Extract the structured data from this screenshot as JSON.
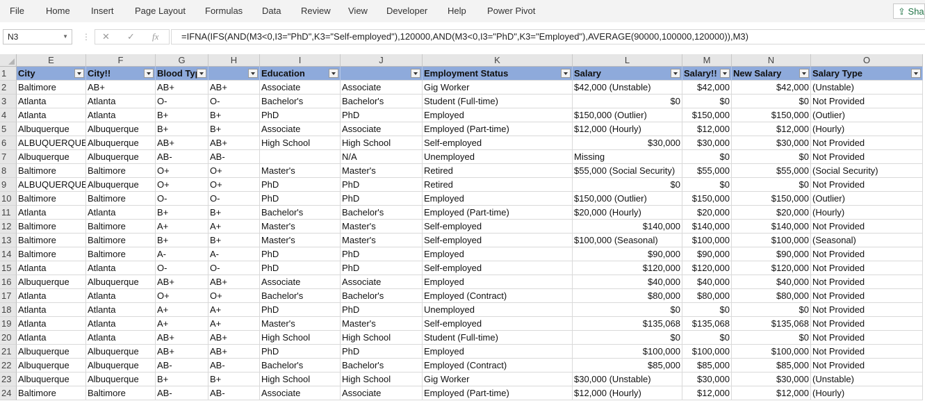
{
  "ribbon": {
    "tabs": [
      "File",
      "Home",
      "Insert",
      "Page Layout",
      "Formulas",
      "Data",
      "Review",
      "View",
      "Developer",
      "Help",
      "Power Pivot"
    ],
    "share_label": "Sha"
  },
  "formula_bar": {
    "name_box": "N3",
    "formula": "=IFNA(IFS(AND(M3<0,I3=\"PhD\",K3=\"Self-employed\"),120000,AND(M3<0,I3=\"PhD\",K3=\"Employed\"),AVERAGE(90000,100000,120000)),M3)"
  },
  "columns": [
    "E",
    "F",
    "G",
    "H",
    "I",
    "J",
    "K",
    "L",
    "M",
    "N",
    "O"
  ],
  "header_row": {
    "number": "1",
    "cells": [
      "City",
      "City!!",
      "Blood Typ",
      "",
      "Education",
      "",
      "Employment Status",
      "Salary",
      "Salary!!",
      "New Salary",
      "Salary Type"
    ]
  },
  "rows": [
    {
      "n": "2",
      "c": [
        "Baltimore",
        "AB+",
        "AB+",
        "AB+",
        "Associate",
        "Associate",
        "Gig Worker",
        "$42,000 (Unstable)",
        "$42,000",
        "$42,000",
        "(Unstable)"
      ]
    },
    {
      "n": "3",
      "c": [
        "Atlanta",
        "Atlanta",
        "O-",
        "O-",
        "Bachelor's",
        "Bachelor's",
        "Student (Full-time)",
        "$0",
        "$0",
        "$0",
        "Not Provided"
      ]
    },
    {
      "n": "4",
      "c": [
        "Atlanta",
        "Atlanta",
        "B+",
        "B+",
        "PhD",
        "PhD",
        "Employed",
        "$150,000 (Outlier)",
        "$150,000",
        "$150,000",
        "(Outlier)"
      ]
    },
    {
      "n": "5",
      "c": [
        "Albuquerque",
        "Albuquerque",
        "B+",
        "B+",
        "Associate",
        "Associate",
        "Employed (Part-time)",
        "$12,000 (Hourly)",
        "$12,000",
        "$12,000",
        "(Hourly)"
      ]
    },
    {
      "n": "6",
      "c": [
        "ALBUQUERQUE",
        "Albuquerque",
        "AB+",
        "AB+",
        "High School",
        "High School",
        "Self-employed",
        "$30,000",
        "$30,000",
        "$30,000",
        "Not Provided"
      ]
    },
    {
      "n": "7",
      "c": [
        "Albuquerque",
        "Albuquerque",
        "AB-",
        "AB-",
        "",
        "N/A",
        "Unemployed",
        "Missing",
        "$0",
        "$0",
        "Not Provided"
      ]
    },
    {
      "n": "8",
      "c": [
        "Baltimore",
        "Baltimore",
        "O+",
        "O+",
        "Master's",
        "Master's",
        "Retired",
        "$55,000 (Social Security)",
        "$55,000",
        "$55,000",
        "(Social Security)"
      ]
    },
    {
      "n": "9",
      "c": [
        "ALBUQUERQUE",
        "Albuquerque",
        "O+",
        "O+",
        "PhD",
        "PhD",
        "Retired",
        "$0",
        "$0",
        "$0",
        "Not Provided"
      ]
    },
    {
      "n": "10",
      "c": [
        "Baltimore",
        "Baltimore",
        "O-",
        "O-",
        "PhD",
        "PhD",
        "Employed",
        "$150,000 (Outlier)",
        "$150,000",
        "$150,000",
        "(Outlier)"
      ]
    },
    {
      "n": "11",
      "c": [
        "Atlanta",
        "Atlanta",
        "B+",
        "B+",
        "Bachelor's",
        "Bachelor's",
        "Employed (Part-time)",
        "$20,000 (Hourly)",
        "$20,000",
        "$20,000",
        "(Hourly)"
      ]
    },
    {
      "n": "12",
      "c": [
        "Baltimore",
        "Baltimore",
        "A+",
        "A+",
        "Master's",
        "Master's",
        "Self-employed",
        "$140,000",
        "$140,000",
        "$140,000",
        "Not Provided"
      ]
    },
    {
      "n": "13",
      "c": [
        "Baltimore",
        "Baltimore",
        "B+",
        "B+",
        "Master's",
        "Master's",
        "Self-employed",
        "$100,000 (Seasonal)",
        "$100,000",
        "$100,000",
        "(Seasonal)"
      ]
    },
    {
      "n": "14",
      "c": [
        "Baltimore",
        "Baltimore",
        "A-",
        "A-",
        "PhD",
        "PhD",
        "Employed",
        "$90,000",
        "$90,000",
        "$90,000",
        "Not Provided"
      ]
    },
    {
      "n": "15",
      "c": [
        "Atlanta",
        "Atlanta",
        "O-",
        "O-",
        "PhD",
        "PhD",
        "Self-employed",
        "$120,000",
        "$120,000",
        "$120,000",
        "Not Provided"
      ]
    },
    {
      "n": "16",
      "c": [
        "Albuquerque",
        "Albuquerque",
        "AB+",
        "AB+",
        "Associate",
        "Associate",
        "Employed",
        "$40,000",
        "$40,000",
        "$40,000",
        "Not Provided"
      ]
    },
    {
      "n": "17",
      "c": [
        "Atlanta",
        "Atlanta",
        "O+",
        "O+",
        "Bachelor's",
        "Bachelor's",
        "Employed (Contract)",
        "$80,000",
        "$80,000",
        "$80,000",
        "Not Provided"
      ]
    },
    {
      "n": "18",
      "c": [
        "Atlanta",
        "Atlanta",
        "A+",
        "A+",
        "PhD",
        "PhD",
        "Unemployed",
        "$0",
        "$0",
        "$0",
        "Not Provided"
      ]
    },
    {
      "n": "19",
      "c": [
        "Atlanta",
        "Atlanta",
        "A+",
        "A+",
        "Master's",
        "Master's",
        "Self-employed",
        "$135,068",
        "$135,068",
        "$135,068",
        "Not Provided"
      ]
    },
    {
      "n": "20",
      "c": [
        "Atlanta",
        "Atlanta",
        "AB+",
        "AB+",
        "High School",
        "High School",
        "Student (Full-time)",
        "$0",
        "$0",
        "$0",
        "Not Provided"
      ]
    },
    {
      "n": "21",
      "c": [
        "Albuquerque",
        "Albuquerque",
        "AB+",
        "AB+",
        "PhD",
        "PhD",
        "Employed",
        "$100,000",
        "$100,000",
        "$100,000",
        "Not Provided"
      ]
    },
    {
      "n": "22",
      "c": [
        "Albuquerque",
        "Albuquerque",
        "AB-",
        "AB-",
        "Bachelor's",
        "Bachelor's",
        "Employed (Contract)",
        "$85,000",
        "$85,000",
        "$85,000",
        "Not Provided"
      ]
    },
    {
      "n": "23",
      "c": [
        "Albuquerque",
        "Albuquerque",
        "B+",
        "B+",
        "High School",
        "High School",
        "Gig Worker",
        "$30,000 (Unstable)",
        "$30,000",
        "$30,000",
        "(Unstable)"
      ]
    },
    {
      "n": "24",
      "c": [
        "Baltimore",
        "Baltimore",
        "AB-",
        "AB-",
        "Associate",
        "Associate",
        "Employed (Part-time)",
        "$12,000 (Hourly)",
        "$12,000",
        "$12,000",
        "(Hourly)"
      ]
    }
  ]
}
